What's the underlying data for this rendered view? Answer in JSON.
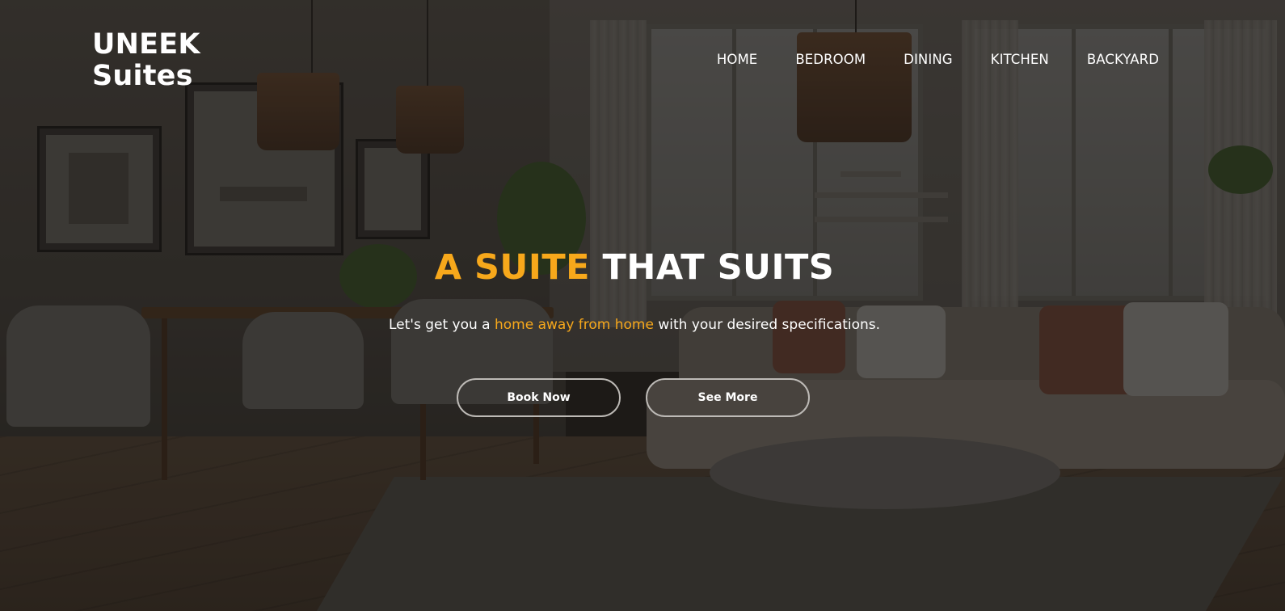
{
  "brand": {
    "line1": "UNEEK",
    "line2": "Suites"
  },
  "nav": {
    "items": [
      "HOME",
      "BEDROOM",
      "DINING",
      "KITCHEN",
      "BACKYARD"
    ]
  },
  "hero": {
    "headline_accent": "A SUITE",
    "headline_rest": "THAT SUITS",
    "tagline_before": "Let's get you a ",
    "tagline_highlight": "home away from home",
    "tagline_after": " with your desired specifications.",
    "primary_button": "Book Now",
    "secondary_button": "See More"
  },
  "colors": {
    "accent": "#f7a81b",
    "text": "#ffffff",
    "button_border": "#bdbab6"
  },
  "background": {
    "depicts": "interior-living-room-photo"
  }
}
